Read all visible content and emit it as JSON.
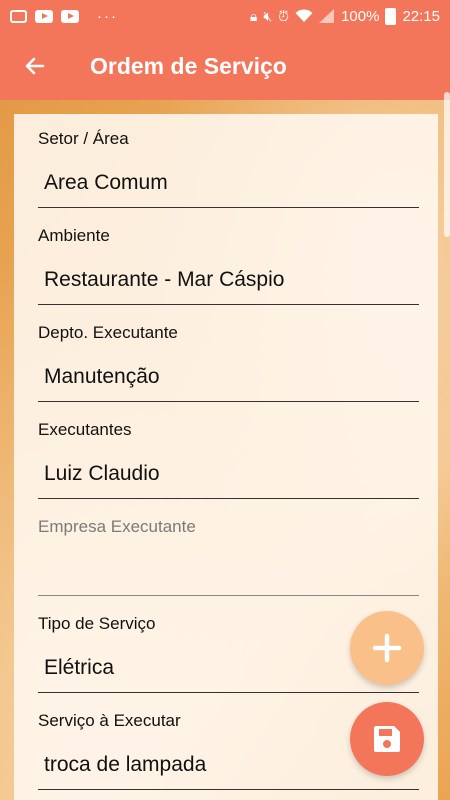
{
  "status_bar": {
    "battery": "100%",
    "time": "22:15",
    "overflow": "···"
  },
  "app_bar": {
    "title": "Ordem de Serviço"
  },
  "form": {
    "fields": [
      {
        "label": "Setor / Área",
        "value": "Area Comum"
      },
      {
        "label": "Ambiente",
        "value": "Restaurante - Mar Cáspio"
      },
      {
        "label": "Depto. Executante",
        "value": "Manutenção"
      },
      {
        "label": "Executantes",
        "value": "Luiz Claudio"
      },
      {
        "placeholder": "Empresa Executante",
        "value": ""
      },
      {
        "label": "Tipo de Serviço",
        "value": "Elétrica"
      },
      {
        "label": "Serviço à Executar",
        "value": "troca de lampada"
      }
    ]
  },
  "colors": {
    "primary": "#f4765a",
    "fab_secondary": "#f9c08a",
    "background": "#e9a24e"
  },
  "icons": {
    "back": "arrow-left-icon",
    "add": "plus-icon",
    "save": "floppy-disk-icon"
  }
}
